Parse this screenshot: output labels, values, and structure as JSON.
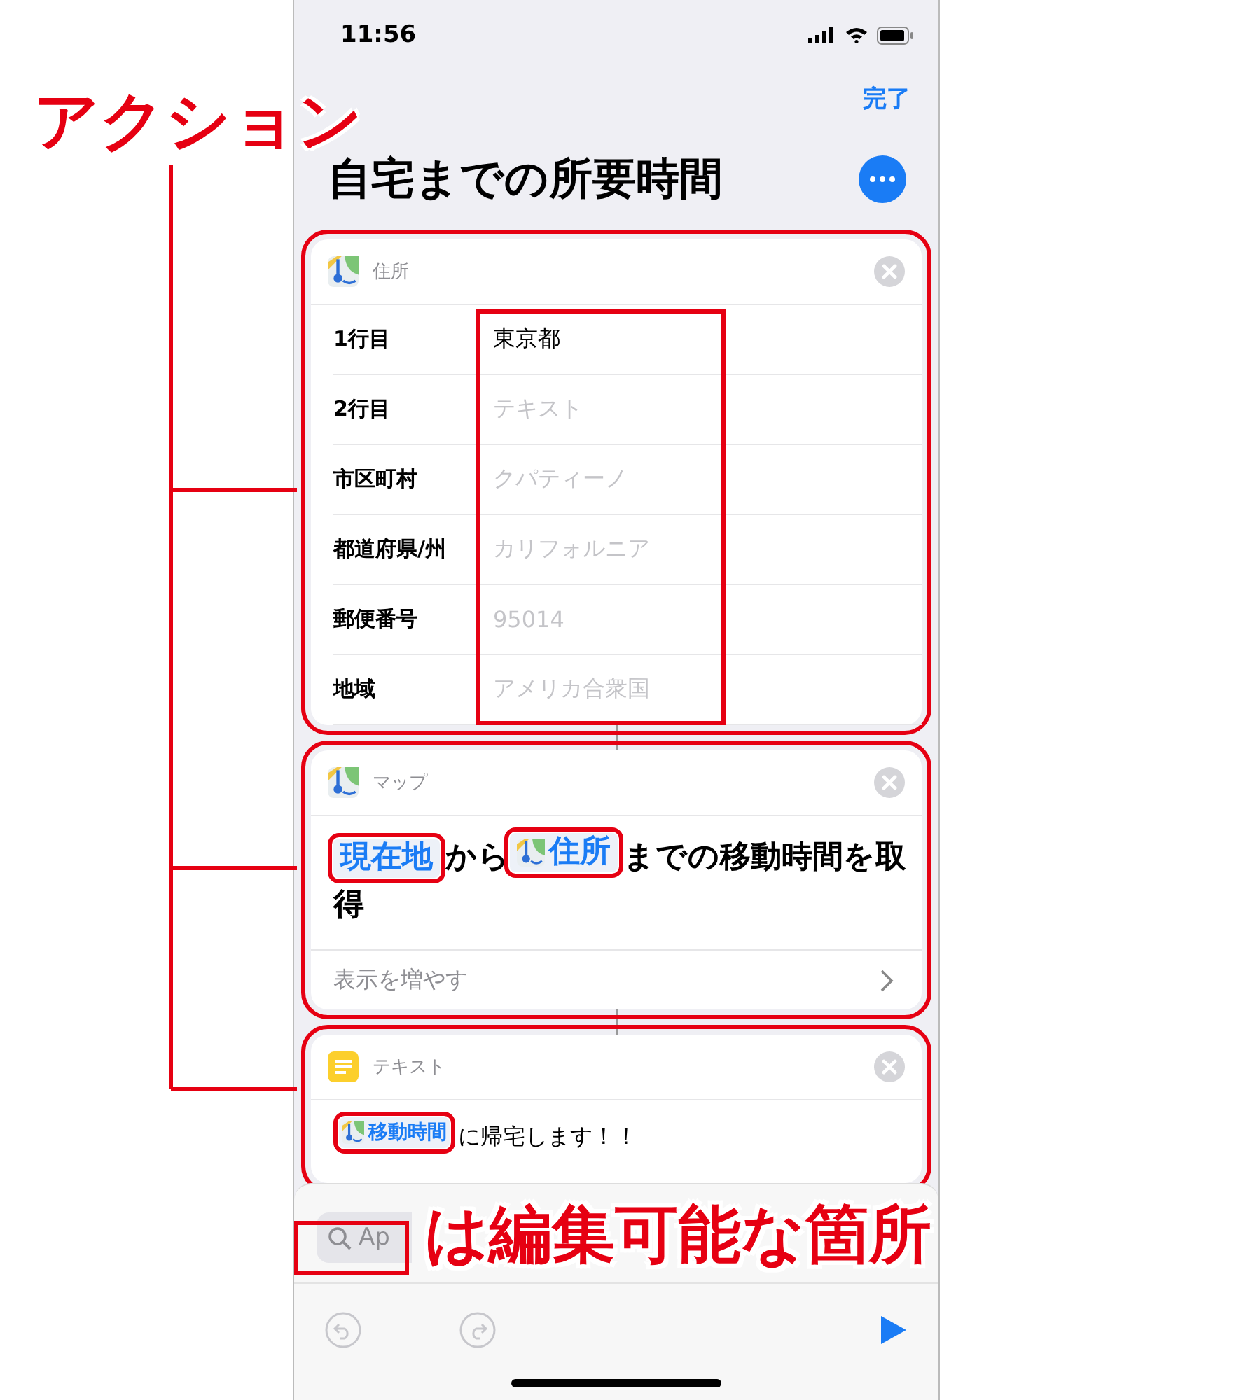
{
  "annotations": {
    "title": "アクション",
    "note": "は編集可能な箇所"
  },
  "status_bar": {
    "time": "11:56"
  },
  "nav": {
    "done": "完了",
    "title": "自宅までの所要時間"
  },
  "cards": [
    {
      "kind": "address",
      "app": "住所",
      "highlighted": true,
      "values_highlighted": true,
      "rows": [
        {
          "label": "1行目",
          "value": "東京都"
        },
        {
          "label": "2行目",
          "placeholder": "テキスト"
        },
        {
          "label": "市区町村",
          "placeholder": "クパティーノ"
        },
        {
          "label": "都道府県/州",
          "placeholder": "カリフォルニア"
        },
        {
          "label": "郵便番号",
          "placeholder": "95014"
        },
        {
          "label": "地域",
          "placeholder": "アメリカ合衆国"
        }
      ]
    },
    {
      "kind": "sentence",
      "app": "マップ",
      "highlighted": true,
      "more": "表示を増やす",
      "parts": [
        {
          "kind": "token",
          "text": "現在地",
          "highlighted": true
        },
        {
          "kind": "text",
          "text": "から"
        },
        {
          "kind": "app_token",
          "text": "住所",
          "highlighted": true
        },
        {
          "kind": "text",
          "text": "までの移動時間を取"
        },
        {
          "kind": "text",
          "text": "得"
        }
      ]
    },
    {
      "kind": "text",
      "app": "テキスト",
      "highlighted": true,
      "parts": [
        {
          "kind": "app_token",
          "text": "移動時間",
          "highlighted": true
        },
        {
          "kind": "text",
          "text": "に帰宅します！！"
        }
      ]
    }
  ],
  "search": {
    "placeholder": "Ap",
    "highlighted": true
  }
}
